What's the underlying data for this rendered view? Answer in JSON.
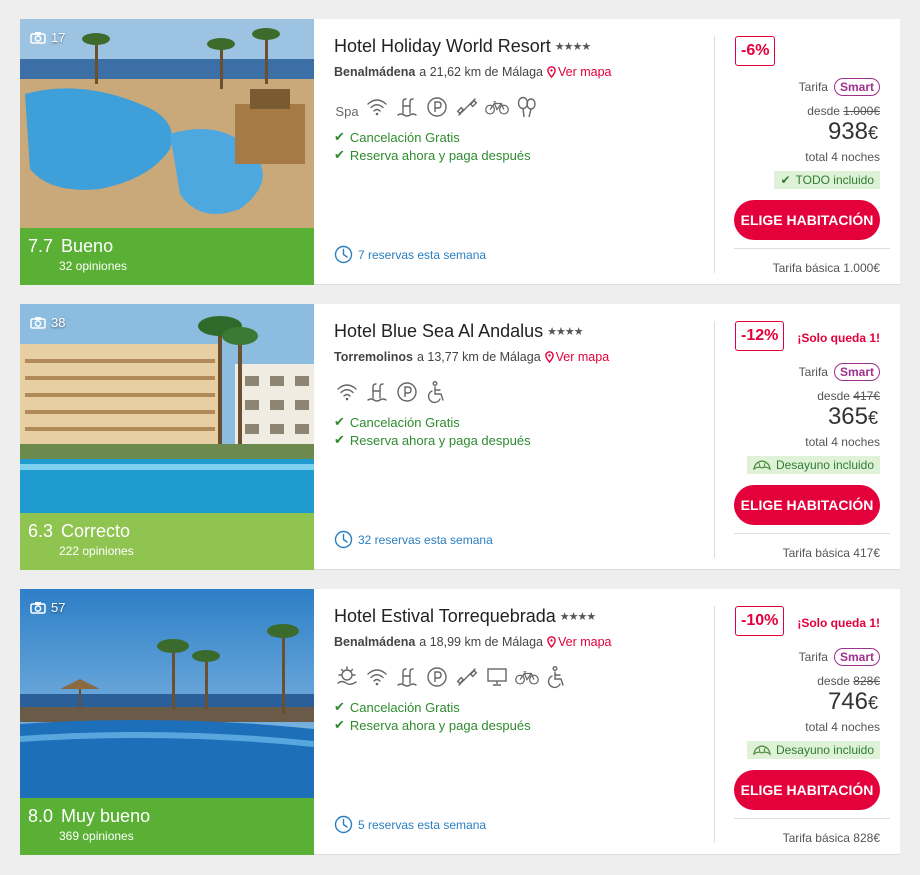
{
  "hotels": [
    {
      "photo_count": "17",
      "score": "7.7",
      "score_label": "Bueno",
      "opinions": "32 opiniones",
      "score_color": "#5ab034",
      "name": "Hotel Holiday World Resort",
      "stars": "★★★★",
      "city": "Benalmádena",
      "distance": "a 21,62 km de Málaga",
      "map_label": "Ver mapa",
      "amenities": [
        "spa-icon",
        "wifi-icon",
        "pool-icon",
        "parking-icon",
        "gym-icon",
        "bike-icon",
        "kids-icon"
      ],
      "spa_label": "Spa",
      "features": [
        "Cancelación Gratis",
        "Reserva ahora y paga después"
      ],
      "week_bookings": "7 reservas esta semana",
      "discount": "-6%",
      "solo": "",
      "tarifa_label": "Tarifa",
      "smart_label": "Smart",
      "desde_label": "desde",
      "old_price": "1.000€",
      "new_price": "938",
      "currency": "€",
      "nights": "total 4 noches",
      "included": "TODO incluido",
      "included_icon": "check-icon",
      "cta": "ELIGE HABITACIÓN",
      "base_rate": "Tarifa básica 1.000€"
    },
    {
      "photo_count": "38",
      "score": "6.3",
      "score_label": "Correcto",
      "opinions": "222 opiniones",
      "score_color": "#8fc451",
      "name": "Hotel Blue Sea Al Andalus",
      "stars": "★★★★",
      "city": "Torremolinos",
      "distance": "a 13,77 km de Málaga",
      "map_label": "Ver mapa",
      "amenities": [
        "wifi-icon",
        "pool-icon",
        "parking-icon",
        "accessible-icon"
      ],
      "features": [
        "Cancelación Gratis",
        "Reserva ahora y paga después"
      ],
      "week_bookings": "32 reservas esta semana",
      "discount": "-12%",
      "solo": "¡Solo queda 1!",
      "tarifa_label": "Tarifa",
      "smart_label": "Smart",
      "desde_label": "desde",
      "old_price": "417€",
      "new_price": "365",
      "currency": "€",
      "nights": "total 4 noches",
      "included": "Desayuno incluido",
      "included_icon": "croissant-icon",
      "cta": "ELIGE HABITACIÓN",
      "base_rate": "Tarifa básica 417€"
    },
    {
      "photo_count": "57",
      "score": "8.0",
      "score_label": "Muy bueno",
      "opinions": "369 opiniones",
      "score_color": "#5ab034",
      "name": "Hotel Estival Torrequebrada",
      "stars": "★★★★",
      "city": "Benalmádena",
      "distance": "a 18,99 km de Málaga",
      "map_label": "Ver mapa",
      "amenities": [
        "beach-icon",
        "wifi-icon",
        "pool-icon",
        "parking-icon",
        "gym-icon",
        "tv-icon",
        "bike-icon",
        "accessible-icon"
      ],
      "features": [
        "Cancelación Gratis",
        "Reserva ahora y paga después"
      ],
      "week_bookings": "5 reservas esta semana",
      "discount": "-10%",
      "solo": "¡Solo queda 1!",
      "tarifa_label": "Tarifa",
      "smart_label": "Smart",
      "desde_label": "desde",
      "old_price": "828€",
      "new_price": "746",
      "currency": "€",
      "nights": "total 4 noches",
      "included": "Desayuno incluido",
      "included_icon": "croissant-icon",
      "cta": "ELIGE HABITACIÓN",
      "base_rate": "Tarifa básica 828€"
    }
  ]
}
